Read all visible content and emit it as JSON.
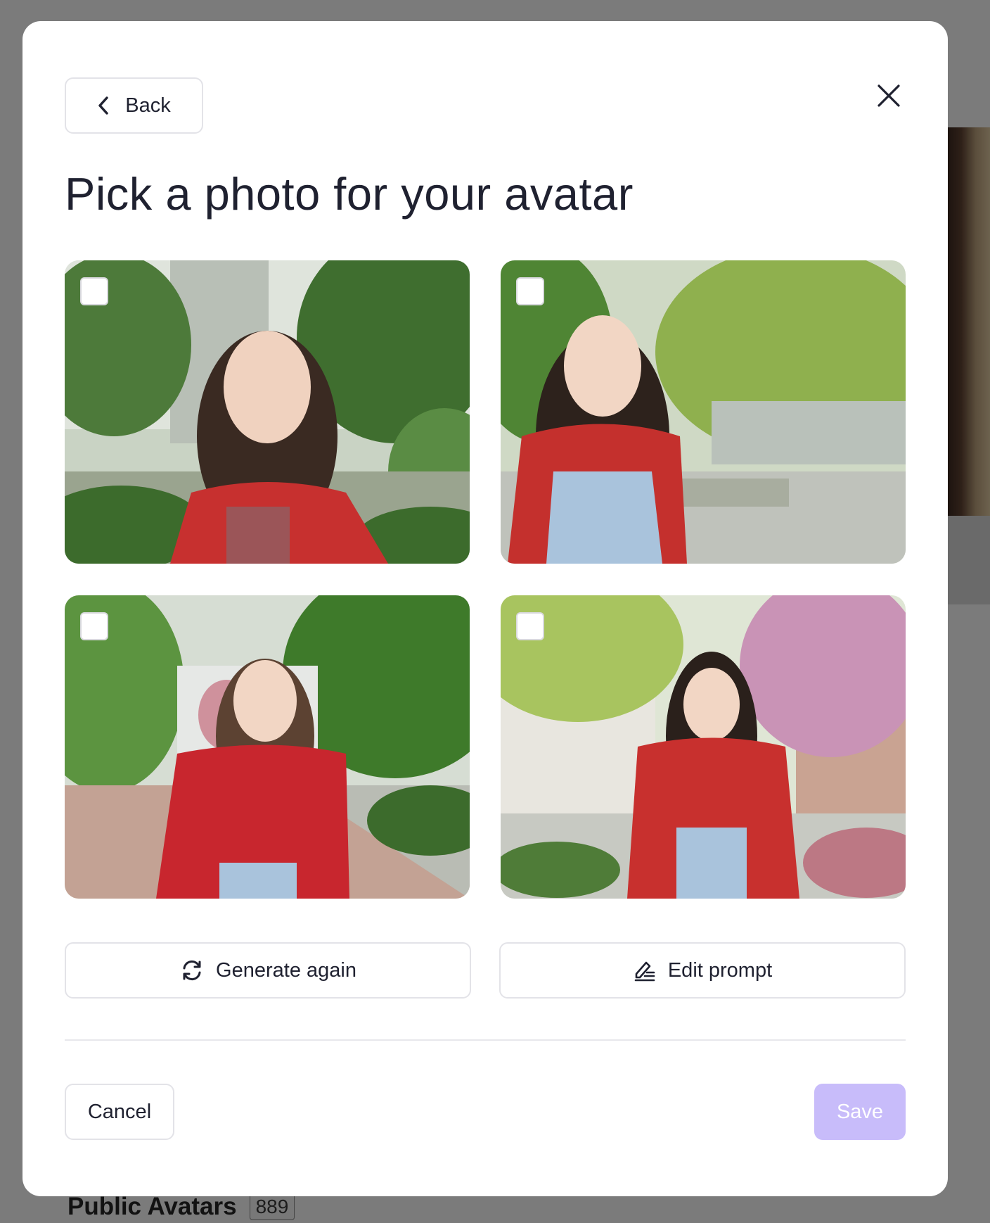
{
  "background": {
    "footer_title": "Public Avatars",
    "footer_count": "889"
  },
  "modal": {
    "back_label": "Back",
    "title": "Pick a photo for your avatar",
    "photos": [
      {
        "selected": false
      },
      {
        "selected": false
      },
      {
        "selected": false
      },
      {
        "selected": false
      }
    ],
    "generate_again_label": "Generate again",
    "edit_prompt_label": "Edit prompt",
    "cancel_label": "Cancel",
    "save_label": "Save",
    "icons": {
      "close": "close-icon",
      "back": "chevron-left-icon",
      "generate": "refresh-icon",
      "edit": "edit-pen-icon"
    },
    "colors": {
      "save_disabled": "#c8bcfa",
      "text": "#1f2130",
      "border": "#e3e3e8"
    }
  }
}
